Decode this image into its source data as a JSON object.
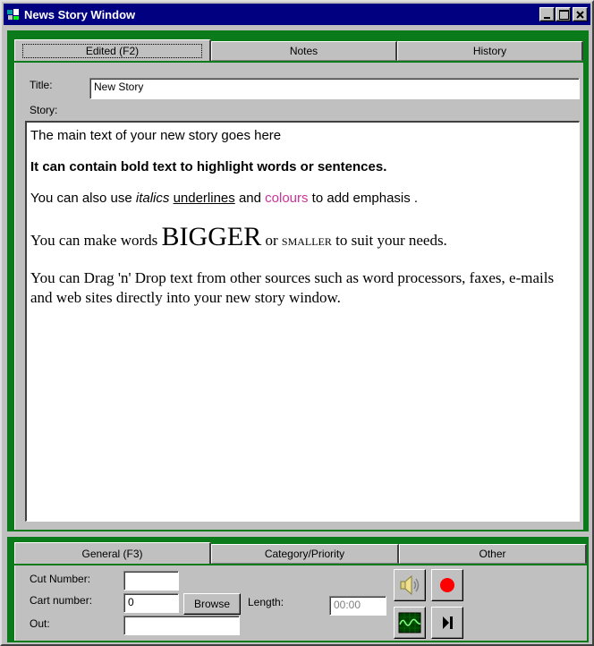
{
  "window": {
    "title": "News Story Window"
  },
  "top_tabs": [
    {
      "label": "Edited (F2)"
    },
    {
      "label": "Notes"
    },
    {
      "label": "History"
    }
  ],
  "form": {
    "title_label": "Title:",
    "title_value": "New Story",
    "story_label": "Story:"
  },
  "story": {
    "p1": "The main text of your new story goes here",
    "p2": "It can contain bold text to highlight words or sentences.",
    "p3_a": "You can also use ",
    "p3_italics": "italics",
    "p3_b": " ",
    "p3_underlines": "underlines",
    "p3_c": " and ",
    "p3_colours": "colours",
    "p3_d": " to add emphasis .",
    "p4_a": "You can make words ",
    "p4_big": "BIGGER",
    "p4_b": " or ",
    "p4_small": "SMALLER",
    "p4_c": " to suit your needs.",
    "p5": "You can Drag 'n' Drop text from other sources such as word processors, faxes, e-mails and web sites directly into your new story window.",
    "colour_emphasis": "#cc3399"
  },
  "bottom_tabs": [
    {
      "label": "General (F3)"
    },
    {
      "label": "Category/Priority"
    },
    {
      "label": "Other"
    }
  ],
  "general": {
    "cut_number_label": "Cut Number:",
    "cut_number_value": "",
    "cart_number_label": "Cart number:",
    "cart_number_value": "0",
    "browse_label": "Browse",
    "length_label": "Length:",
    "length_value": "00:00",
    "out_label": "Out:",
    "out_value": ""
  },
  "icons": {
    "speaker": "speaker-icon",
    "record": "record-icon",
    "waveform": "waveform-icon",
    "play_skip": "skip-forward-icon"
  },
  "colors": {
    "title_bar": "#000080",
    "panel_green": "#0a7a1a",
    "record_red": "#ff0000"
  }
}
